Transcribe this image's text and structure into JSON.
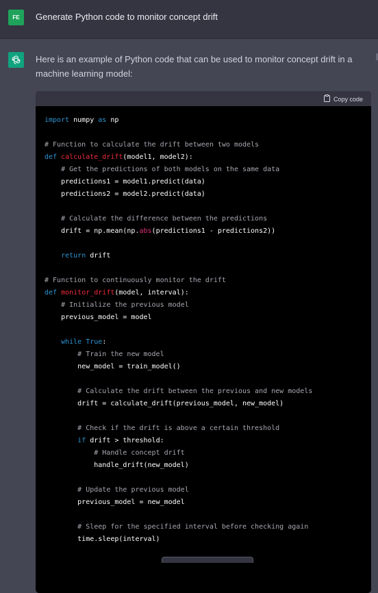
{
  "user": {
    "avatar_initials": "FE",
    "message": "Generate Python code to monitor concept drift"
  },
  "assistant": {
    "avatar_icon": "openai-logo-icon",
    "intro": "Here is an example of Python code that can be used to monitor concept drift in a machine learning model:"
  },
  "code": {
    "copy_label": "Copy code",
    "copy_icon": "clipboard-icon",
    "language": "python",
    "lines": [
      [
        {
          "t": "import",
          "c": "kw"
        },
        {
          "t": " numpy "
        },
        {
          "t": "as",
          "c": "kw"
        },
        {
          "t": " np"
        }
      ],
      [],
      [
        {
          "t": "# Function to calculate the drift between two models",
          "c": "cm"
        }
      ],
      [
        {
          "t": "def",
          "c": "kw"
        },
        {
          "t": " "
        },
        {
          "t": "calculate_drift",
          "c": "fn"
        },
        {
          "t": "(model1, model2):"
        }
      ],
      [
        {
          "t": "    "
        },
        {
          "t": "# Get the predictions of both models on the same data",
          "c": "cm"
        }
      ],
      [
        {
          "t": "    predictions1 = model1.predict(data)"
        }
      ],
      [
        {
          "t": "    predictions2 = model2.predict(data)"
        }
      ],
      [],
      [
        {
          "t": "    "
        },
        {
          "t": "# Calculate the difference between the predictions",
          "c": "cm"
        }
      ],
      [
        {
          "t": "    drift = np.mean(np."
        },
        {
          "t": "abs",
          "c": "bi"
        },
        {
          "t": "(predictions1 - predictions2))"
        }
      ],
      [],
      [
        {
          "t": "    "
        },
        {
          "t": "return",
          "c": "kw"
        },
        {
          "t": " drift"
        }
      ],
      [],
      [
        {
          "t": "# Function to continuously monitor the drift",
          "c": "cm"
        }
      ],
      [
        {
          "t": "def",
          "c": "kw"
        },
        {
          "t": " "
        },
        {
          "t": "monitor_drift",
          "c": "fn"
        },
        {
          "t": "(model, interval):"
        }
      ],
      [
        {
          "t": "    "
        },
        {
          "t": "# Initialize the previous model",
          "c": "cm"
        }
      ],
      [
        {
          "t": "    previous_model = model"
        }
      ],
      [],
      [
        {
          "t": "    "
        },
        {
          "t": "while",
          "c": "kw"
        },
        {
          "t": " "
        },
        {
          "t": "True",
          "c": "kw"
        },
        {
          "t": ":"
        }
      ],
      [
        {
          "t": "        "
        },
        {
          "t": "# Train the new model",
          "c": "cm"
        }
      ],
      [
        {
          "t": "        new_model = train_model()"
        }
      ],
      [],
      [
        {
          "t": "        "
        },
        {
          "t": "# Calculate the drift between the previous and new models",
          "c": "cm"
        }
      ],
      [
        {
          "t": "        drift = calculate_drift(previous_model, new_model)"
        }
      ],
      [],
      [
        {
          "t": "        "
        },
        {
          "t": "# Check if the drift is above a certain threshold",
          "c": "cm"
        }
      ],
      [
        {
          "t": "        "
        },
        {
          "t": "if",
          "c": "kw"
        },
        {
          "t": " drift > threshold:"
        }
      ],
      [
        {
          "t": "            "
        },
        {
          "t": "# Handle concept drift",
          "c": "cm"
        }
      ],
      [
        {
          "t": "            handle_drift(new_model)"
        }
      ],
      [],
      [
        {
          "t": "        "
        },
        {
          "t": "# Update the previous model",
          "c": "cm"
        }
      ],
      [
        {
          "t": "        previous_model = new_model"
        }
      ],
      [],
      [
        {
          "t": "        "
        },
        {
          "t": "# Sleep for the specified interval before checking again",
          "c": "cm"
        }
      ],
      [
        {
          "t": "        time.sleep(interval)"
        }
      ]
    ]
  }
}
